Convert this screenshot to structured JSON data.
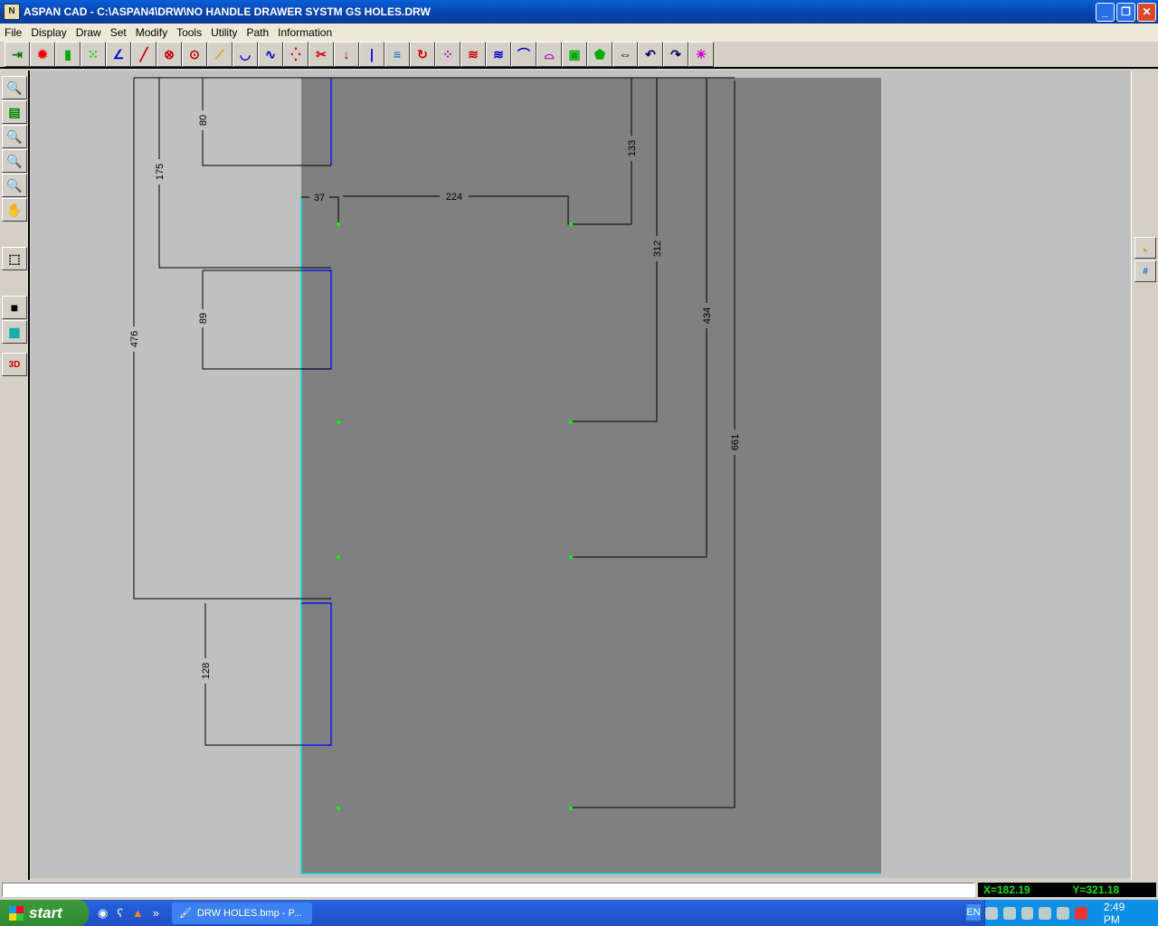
{
  "window": {
    "title": "ASPAN CAD - C:\\ASPAN4\\DRW\\NO HANDLE DRAWER SYSTM GS HOLES.DRW",
    "app_icon": "aspan-logo-icon"
  },
  "menu": [
    "File",
    "Display",
    "Draw",
    "Set",
    "Modify",
    "Tools",
    "Utility",
    "Path",
    "Information"
  ],
  "dimensions": {
    "d80": "80",
    "d175": "175",
    "d89": "89",
    "d476": "476",
    "d128": "128",
    "d37": "37",
    "d224": "224",
    "d133": "133",
    "d312": "312",
    "d434": "434",
    "d661": "661"
  },
  "status": {
    "x": "X=182.19",
    "y": "Y=321.18",
    "message": ""
  },
  "taskbar": {
    "start": "start",
    "quicklaunch_more": "»",
    "task": "DRW HOLES.bmp - P...",
    "lang": "EN",
    "clock": "2:49 PM"
  },
  "colors": {
    "sheet": "#808080",
    "outline": "#0000ff",
    "sheet_border": "#00e0e0",
    "hole": "#00ff00",
    "coords": "#19e019"
  }
}
